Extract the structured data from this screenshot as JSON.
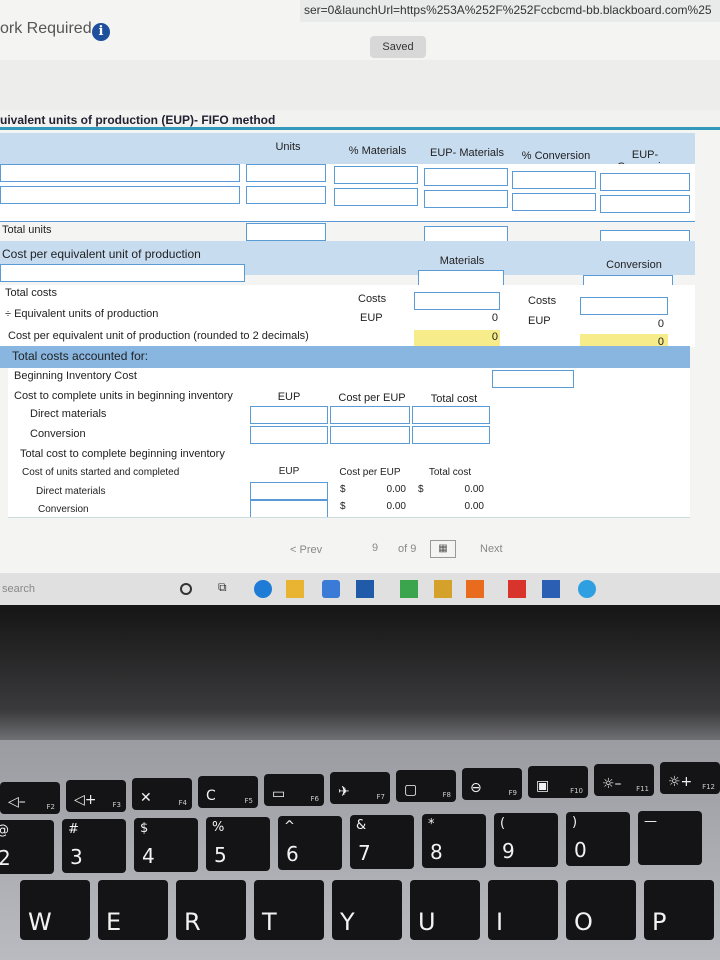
{
  "browser": {
    "url_fragment": "ser=0&launchUrl=https%253A%252F%252Fccbcmd-bb.blackboard.com%25"
  },
  "header": {
    "work_required": "ork Required",
    "info_icon": "info-icon",
    "saved_badge": "Saved"
  },
  "worksheet": {
    "title": "uivalent units of production (EUP)- FIFO method",
    "columns": [
      "Units",
      "% Materials",
      "EUP- Materials",
      "% Conversion",
      "EUP-\nConversion"
    ],
    "total_units": "Total units",
    "cost_per_eup_label": "Cost per equivalent unit of production",
    "materials_header": "Materials",
    "conversion_header": "Conversion",
    "cost_rows": {
      "total_costs": "Total costs",
      "eup": "÷ Equivalent units of production",
      "cost_per_eup": "Cost per equivalent unit of production (rounded to 2 decimals)",
      "costs_label": "Costs",
      "eup_label": "EUP",
      "materials_eup_value": "0",
      "materials_result_value": "0",
      "conversion_eup_value": "0",
      "conversion_result_value": "0"
    },
    "accounted_header": "Total costs accounted for:",
    "beginning_inventory_cost": "Beginning Inventory Cost",
    "complete_beginning": {
      "label": "Cost to complete units in beginning inventory",
      "col_eup": "EUP",
      "col_cost_per_eup": "Cost per EUP",
      "col_total_cost": "Total cost",
      "rows": [
        "Direct materials",
        "Conversion"
      ]
    },
    "total_complete_beginning": "Total cost to complete beginning inventory",
    "started_completed": {
      "label": "Cost of units started and completed",
      "col_eup": "EUP",
      "col_cost_per_eup": "Cost per EUP",
      "col_total_cost": "Total cost",
      "rows": [
        {
          "name": "Direct materials",
          "dollar1": "$",
          "cost_per_eup": "0.00",
          "dollar2": "$",
          "total": "0.00"
        },
        {
          "name": "Conversion",
          "dollar1": "$",
          "cost_per_eup": "0.00",
          "dollar2": "",
          "total": "0.00"
        }
      ]
    }
  },
  "pager": {
    "prev": "< Prev",
    "current": "9",
    "of": "of 9",
    "next": "Next"
  },
  "taskbar": {
    "search": "search"
  },
  "keyboard": {
    "fn_row": [
      {
        "sym": "◁–",
        "fn": "F2"
      },
      {
        "sym": "◁+",
        "fn": "F3"
      },
      {
        "sym": "✕",
        "fn": "F4"
      },
      {
        "sym": "C",
        "fn": "F5"
      },
      {
        "sym": "▭",
        "fn": "F6"
      },
      {
        "sym": "✈",
        "fn": "F7"
      },
      {
        "sym": "▢",
        "fn": "F8"
      },
      {
        "sym": "⊖",
        "fn": "F9"
      },
      {
        "sym": "▣",
        "fn": "F10"
      },
      {
        "sym": "☼–",
        "fn": "F11"
      },
      {
        "sym": "☼+",
        "fn": "F12"
      }
    ],
    "num_row": [
      {
        "top": "@",
        "main": "2"
      },
      {
        "top": "#",
        "main": "3"
      },
      {
        "top": "$",
        "main": "4"
      },
      {
        "top": "%",
        "main": "5"
      },
      {
        "top": "^",
        "main": "6"
      },
      {
        "top": "&",
        "main": "7"
      },
      {
        "top": "*",
        "main": "8"
      },
      {
        "top": "(",
        "main": "9"
      },
      {
        "top": ")",
        "main": "0"
      },
      {
        "top": "—",
        "main": ""
      }
    ],
    "letter_row": [
      "W",
      "E",
      "R",
      "T",
      "Y",
      "U",
      "I",
      "O",
      "P"
    ]
  }
}
